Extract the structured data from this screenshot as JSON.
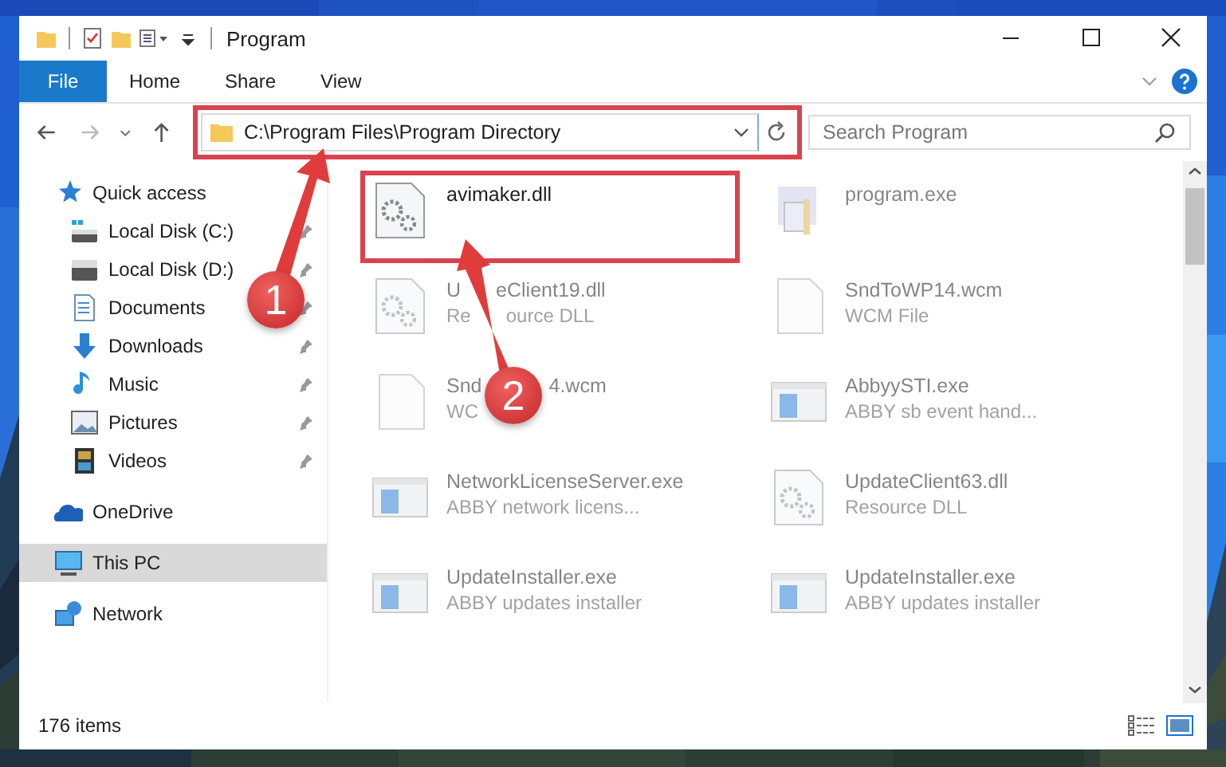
{
  "window": {
    "title": "Program"
  },
  "ribbon_tabs": [
    {
      "label": "File",
      "kind": "menu"
    },
    {
      "label": "Home",
      "kind": "tab"
    },
    {
      "label": "Share",
      "kind": "tab"
    },
    {
      "label": "View",
      "kind": "tab"
    }
  ],
  "address": {
    "path": "C:\\Program Files\\Program Directory",
    "highlighted": true
  },
  "search": {
    "placeholder": "Search Program"
  },
  "nav": [
    {
      "label": "Quick access",
      "selected": false,
      "children": [
        {
          "label": "Local Disk (C:)",
          "pinned": true,
          "selected": false
        },
        {
          "label": "Local Disk (D:)",
          "pinned": true,
          "selected": false
        },
        {
          "label": "Documents",
          "pinned": true,
          "selected": false
        },
        {
          "label": "Downloads",
          "pinned": true,
          "selected": false
        },
        {
          "label": "Music",
          "pinned": true,
          "selected": false
        },
        {
          "label": "Pictures",
          "pinned": true,
          "selected": false
        },
        {
          "label": "Videos",
          "pinned": true,
          "selected": false
        }
      ]
    },
    {
      "label": "OneDrive",
      "selected": false
    },
    {
      "label": "This PC",
      "selected": true
    },
    {
      "label": "Network",
      "selected": false
    }
  ],
  "files": [
    {
      "name": [
        "avimaker.dll"
      ],
      "kind": "library",
      "highlighted": true,
      "blurred": false
    },
    {
      "name": [
        "program.exe"
      ],
      "kind": "program",
      "highlighted": false,
      "blurred": true
    },
    {
      "name": [
        "U",
        "eClient19.dll"
      ],
      "description": [
        "Re",
        "ource DLL"
      ],
      "kind": "library",
      "highlighted": false,
      "blurred": true
    },
    {
      "name": [
        "SndToWP14.wcm"
      ],
      "description": [
        "WCM File"
      ],
      "kind": "document",
      "highlighted": false,
      "blurred": true
    },
    {
      "name": [
        "Snd",
        "4.wcm"
      ],
      "description": [
        "WC"
      ],
      "kind": "document",
      "highlighted": false,
      "blurred": true
    },
    {
      "name": [
        "AbbyySTI.exe"
      ],
      "description": [
        "ABBY sb event hand..."
      ],
      "kind": "application",
      "highlighted": false,
      "blurred": true
    },
    {
      "name": [
        "NetworkLicenseServer.exe"
      ],
      "description": [
        "ABBY network licens..."
      ],
      "kind": "application",
      "highlighted": false,
      "blurred": true
    },
    {
      "name": [
        "UpdateClient63.dll"
      ],
      "description": [
        "Resource DLL"
      ],
      "kind": "library",
      "highlighted": false,
      "blurred": true
    },
    {
      "name": [
        "UpdateInstaller.exe"
      ],
      "description": [
        "ABBY updates installer"
      ],
      "kind": "application",
      "highlighted": false,
      "blurred": true
    },
    {
      "name": [
        "UpdateInstaller.exe"
      ],
      "description": [
        "ABBY updates installer"
      ],
      "kind": "application",
      "highlighted": false,
      "blurred": true
    }
  ],
  "status_bar": {
    "item_count": "176 items"
  },
  "annotations": [
    {
      "label": "1"
    },
    {
      "label": "2"
    }
  ]
}
